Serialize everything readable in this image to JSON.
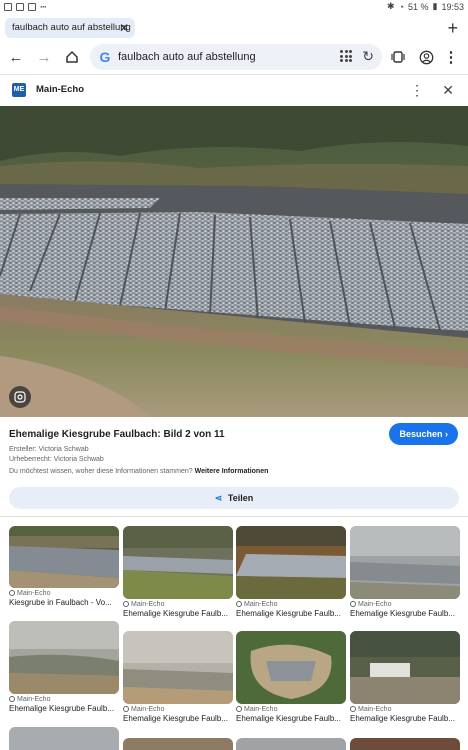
{
  "status_bar": {
    "battery": "51 %",
    "time": "19:53"
  },
  "tab": {
    "title": "faulbach auto auf abstellung"
  },
  "omnibox": {
    "query": "faulbach auto auf abstellung"
  },
  "source": {
    "logo_text": "ME",
    "name": "Main-Echo"
  },
  "image_info": {
    "title": "Ehemalige Kiesgrube Faulbach: Bild 2 von 11",
    "visit_label": "Besuchen",
    "creator_label": "Ersteller:",
    "creator": "Victoria Schwab",
    "copyright_label": "Urheberrecht:",
    "copyright": "Victoria Schwab",
    "question": "Du möchtest wissen, woher diese Informationen stammen?",
    "more_info": "Weitere Informationen",
    "share_label": "Teilen"
  },
  "related": [
    {
      "source": "Main-Echo",
      "caption": "Kiesgrube in Faulbach - Vo..."
    },
    {
      "source": "Main-Echo",
      "caption": "Ehemalige Kiesgrube Faulb..."
    },
    {
      "source": "Main-Echo",
      "caption": "Ehemalige Kiesgrube Faulb..."
    },
    {
      "source": "Main-Echo",
      "caption": "Ehemalige Kiesgrube Faulb..."
    },
    {
      "source": "Main-Echo",
      "caption": "Ehemalige Kiesgrube Faulb..."
    },
    {
      "source": "Main-Echo",
      "caption": "Ehemalige Kiesgrube Faulb..."
    },
    {
      "source": "Main-Echo",
      "caption": "Ehemalige Kiesgrube Faulb..."
    },
    {
      "source": "Main-Echo",
      "caption": "Ehemalige Kiesgrube Faulb..."
    }
  ]
}
